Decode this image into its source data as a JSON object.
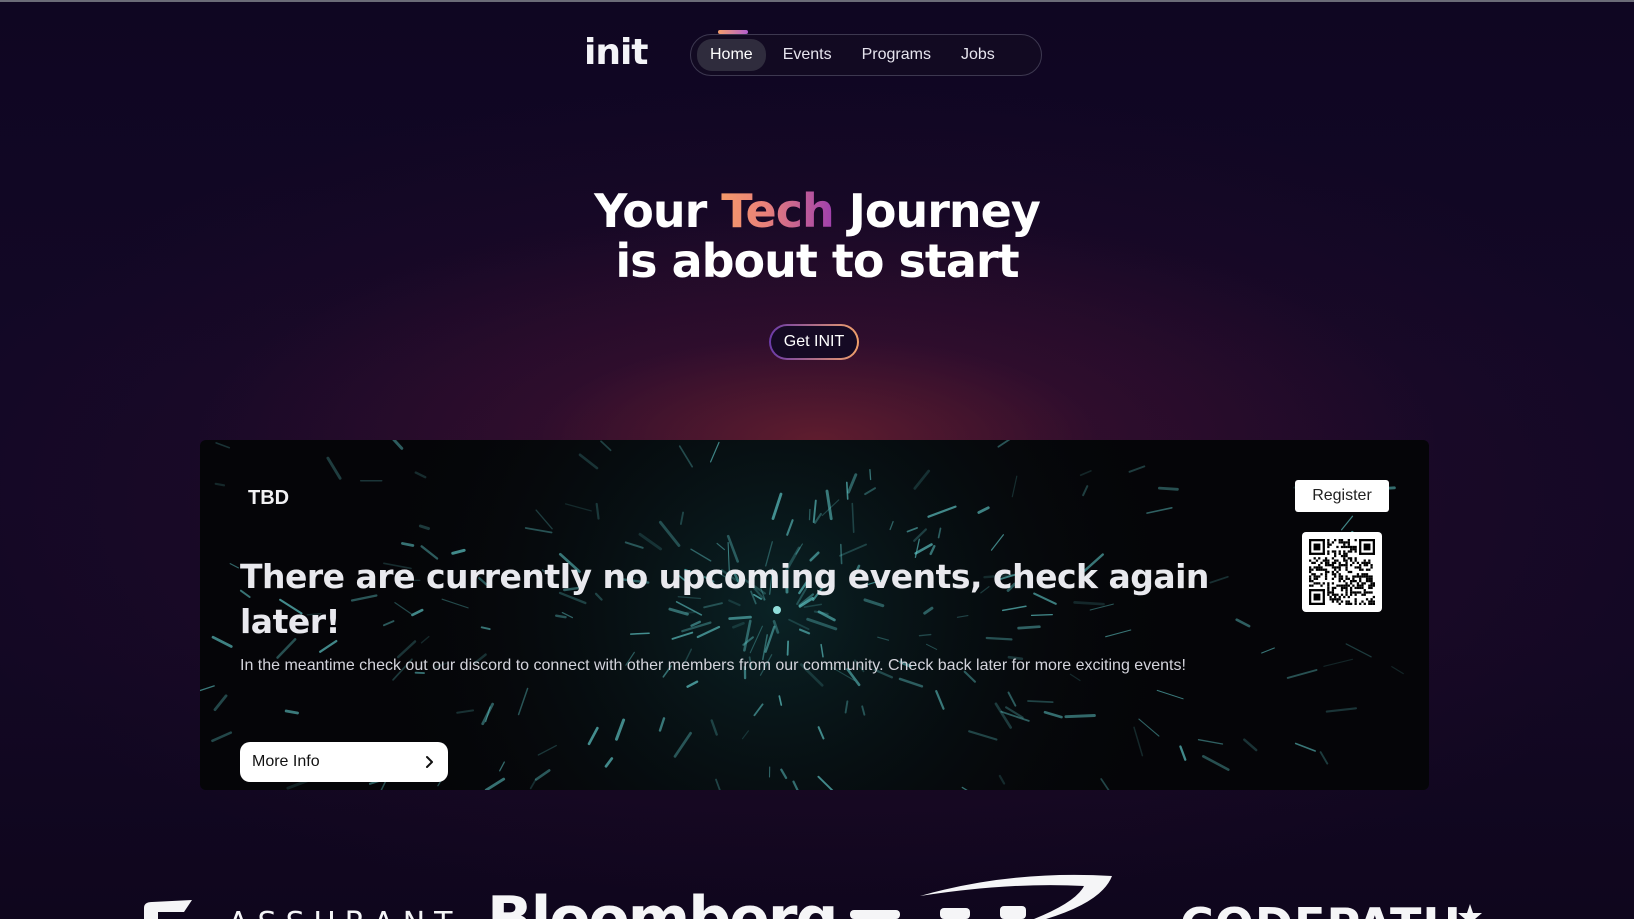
{
  "header": {
    "logo": "init",
    "nav": [
      {
        "label": "Home",
        "active": true
      },
      {
        "label": "Events",
        "active": false
      },
      {
        "label": "Programs",
        "active": false
      },
      {
        "label": "Jobs",
        "active": false
      }
    ]
  },
  "hero": {
    "line1_prefix": "Your ",
    "line1_highlight": "Tech",
    "line1_suffix": " Journey",
    "line2": "is about to start",
    "cta_label": "Get INIT"
  },
  "event": {
    "date": "TBD",
    "headline": "There are currently no upcoming events, check again later!",
    "description": "In the meantime check out our discord to connect with other members from our community. Check back later for more exciting events!",
    "more_info_label": "More Info",
    "register_label": "Register",
    "qr_icon": "qr-code-icon",
    "chevron_icon": "chevron-right-icon"
  },
  "sponsors": {
    "names": [
      "ASSURANT",
      "Bloomberg",
      "CODEPATH"
    ]
  },
  "colors": {
    "background": "#0f0720",
    "accent_orange": "#f59a6a",
    "accent_purple": "#9e3fae",
    "card": "#050508"
  }
}
